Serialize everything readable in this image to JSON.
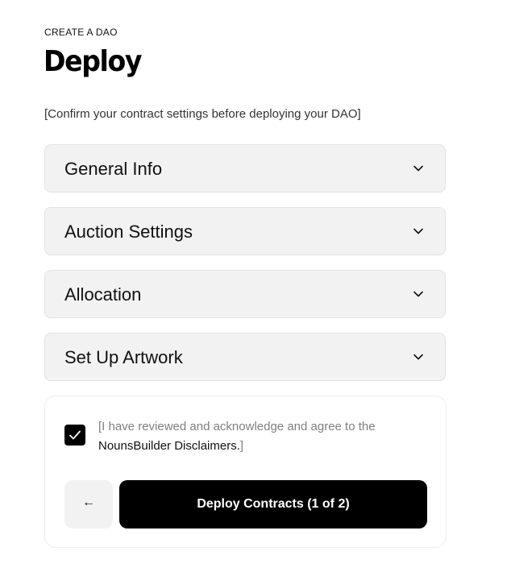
{
  "header": {
    "eyebrow": "CREATE A DAO",
    "title": "Deploy",
    "subtitle": "[Confirm your contract settings before deploying your DAO]"
  },
  "sections": [
    {
      "label": "General Info",
      "icon": "chevron-down-icon"
    },
    {
      "label": "Auction Settings",
      "icon": "chevron-down-icon"
    },
    {
      "label": "Allocation",
      "icon": "chevron-down-icon"
    },
    {
      "label": "Set Up Artwork",
      "icon": "chevron-down-icon"
    }
  ],
  "confirm": {
    "checked": true,
    "text_prefix": "[I have reviewed and acknowledge and agree to the",
    "link_text": "NounsBuilder Disclaimers.",
    "text_suffix": "]",
    "back_arrow": "←",
    "deploy_label": "Deploy Contracts (1 of 2)"
  },
  "colors": {
    "accordion_bg": "#f2f2f2",
    "primary_button": "#000000",
    "primary_button_text": "#ffffff"
  }
}
